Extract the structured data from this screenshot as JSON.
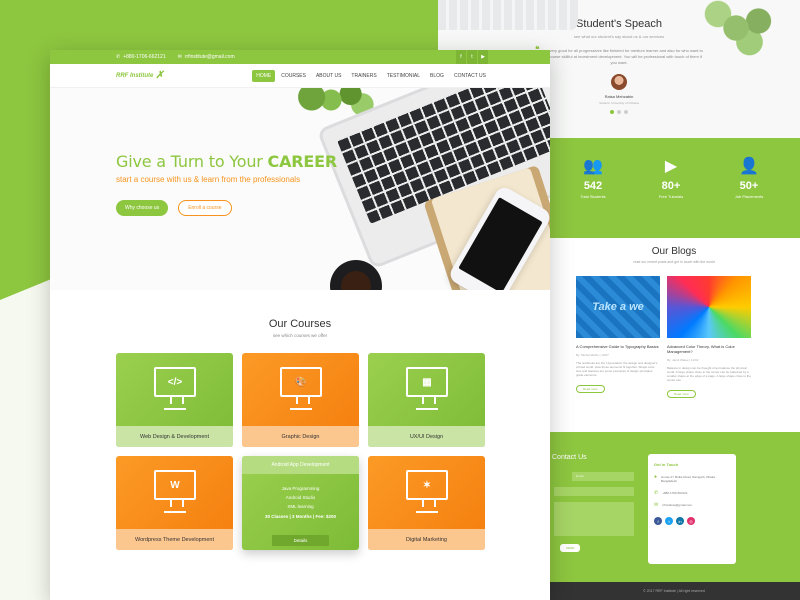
{
  "topbar": {
    "phone": "+880-1706-662121",
    "email": "rrfinstitute@gmail.com",
    "social_icons": [
      "facebook-icon",
      "twitter-icon",
      "youtube-icon"
    ]
  },
  "logo": {
    "text": "RRF Institute"
  },
  "nav": {
    "items": [
      "HOME",
      "COURSES",
      "ABOUT US",
      "TRAINERS",
      "TESTIMONIAL",
      "BLOG",
      "CONTACT US"
    ],
    "active": "HOME"
  },
  "hero": {
    "headline_prefix": "Give a Turn to Your ",
    "headline_emphasis": "CAREER",
    "subheadline": "start a course with us & learn from the professionals",
    "primary_button": "Why choose us",
    "secondary_button": "Enroll a course"
  },
  "courses": {
    "title": "Our Courses",
    "subtitle": "see which courses we offer",
    "items": [
      {
        "label": "Web Design & Development",
        "icon": "code-icon",
        "glyph": "</>"
      },
      {
        "label": "Graphic Design",
        "icon": "palette-icon",
        "glyph": "🎨"
      },
      {
        "label": "UX/UI Design",
        "icon": "grid-icon",
        "glyph": "▦"
      },
      {
        "label": "Wordpress Theme Development",
        "icon": "wordpress-icon",
        "glyph": "W"
      },
      {
        "label": "Digital Marketing",
        "icon": "network-icon",
        "glyph": "✶"
      }
    ],
    "featured": {
      "title": "Android App Development",
      "lines": [
        "Java Programming",
        "Android Studio",
        "XML learning"
      ],
      "meta": "30 Classes  |  3 Months  |  Fee: $200",
      "button": "Details"
    }
  },
  "testimonial": {
    "title": "Student's Speach",
    "subtitle": "see what our student's say about us & our services",
    "quote": "ama very good for all progressives like finished for medium learner and also for who want to be a recourse skillful at investment development. You will be professional with touch of them if you want.",
    "name": "Raisa Mehzabin",
    "role": "Student, University of Chhana"
  },
  "stats": [
    {
      "icon": "users-icon",
      "glyph": "👥",
      "value": "542",
      "label": "Total Students"
    },
    {
      "icon": "youtube-icon",
      "glyph": "▶",
      "value": "80+",
      "label": "Free Tutorials"
    },
    {
      "icon": "person-badge-icon",
      "glyph": "👤",
      "value": "50+",
      "label": "Job Placements"
    }
  ],
  "blogs": {
    "title": "Our Blogs",
    "subtitle": "read our recent posts and get in touch with the world",
    "items": [
      {
        "title": "A Comprehensive Guide to Typography Basics",
        "meta": "By: Michel Mahin  |  12/07",
        "text": "The textbooks are the 'Hypostatics' the design and designer's printed world. How those elements fit together. Shape color size and features are some examples of design principles guide elements.",
        "button": "Read more"
      },
      {
        "title": "Advanced Color Theory. What is Color Management?",
        "meta": "By: Jamil Wafee  |  12/02",
        "text": "Balance in design can be thought of as balance the physical world. A large shape close to the center can be balanced by a smaller shape at the edge of a page. A large shape close to the center can.",
        "button": "Read more"
      }
    ]
  },
  "contact": {
    "title": "Contact Us",
    "email_placeholder": "Email",
    "send": "SEND",
    "card_title": "Get in Touch",
    "address": "House 27 Mollie Road, Ramgarh, Dhaka Bangladesh",
    "phone": "+880-1706-662121",
    "email": "rrfinstitute@gmail.com"
  },
  "footer": {
    "text": "© 2017 RRF Institute | All right reserved"
  },
  "colors": {
    "primary_green": "#8dc63f",
    "accent_orange": "#f7931e"
  }
}
